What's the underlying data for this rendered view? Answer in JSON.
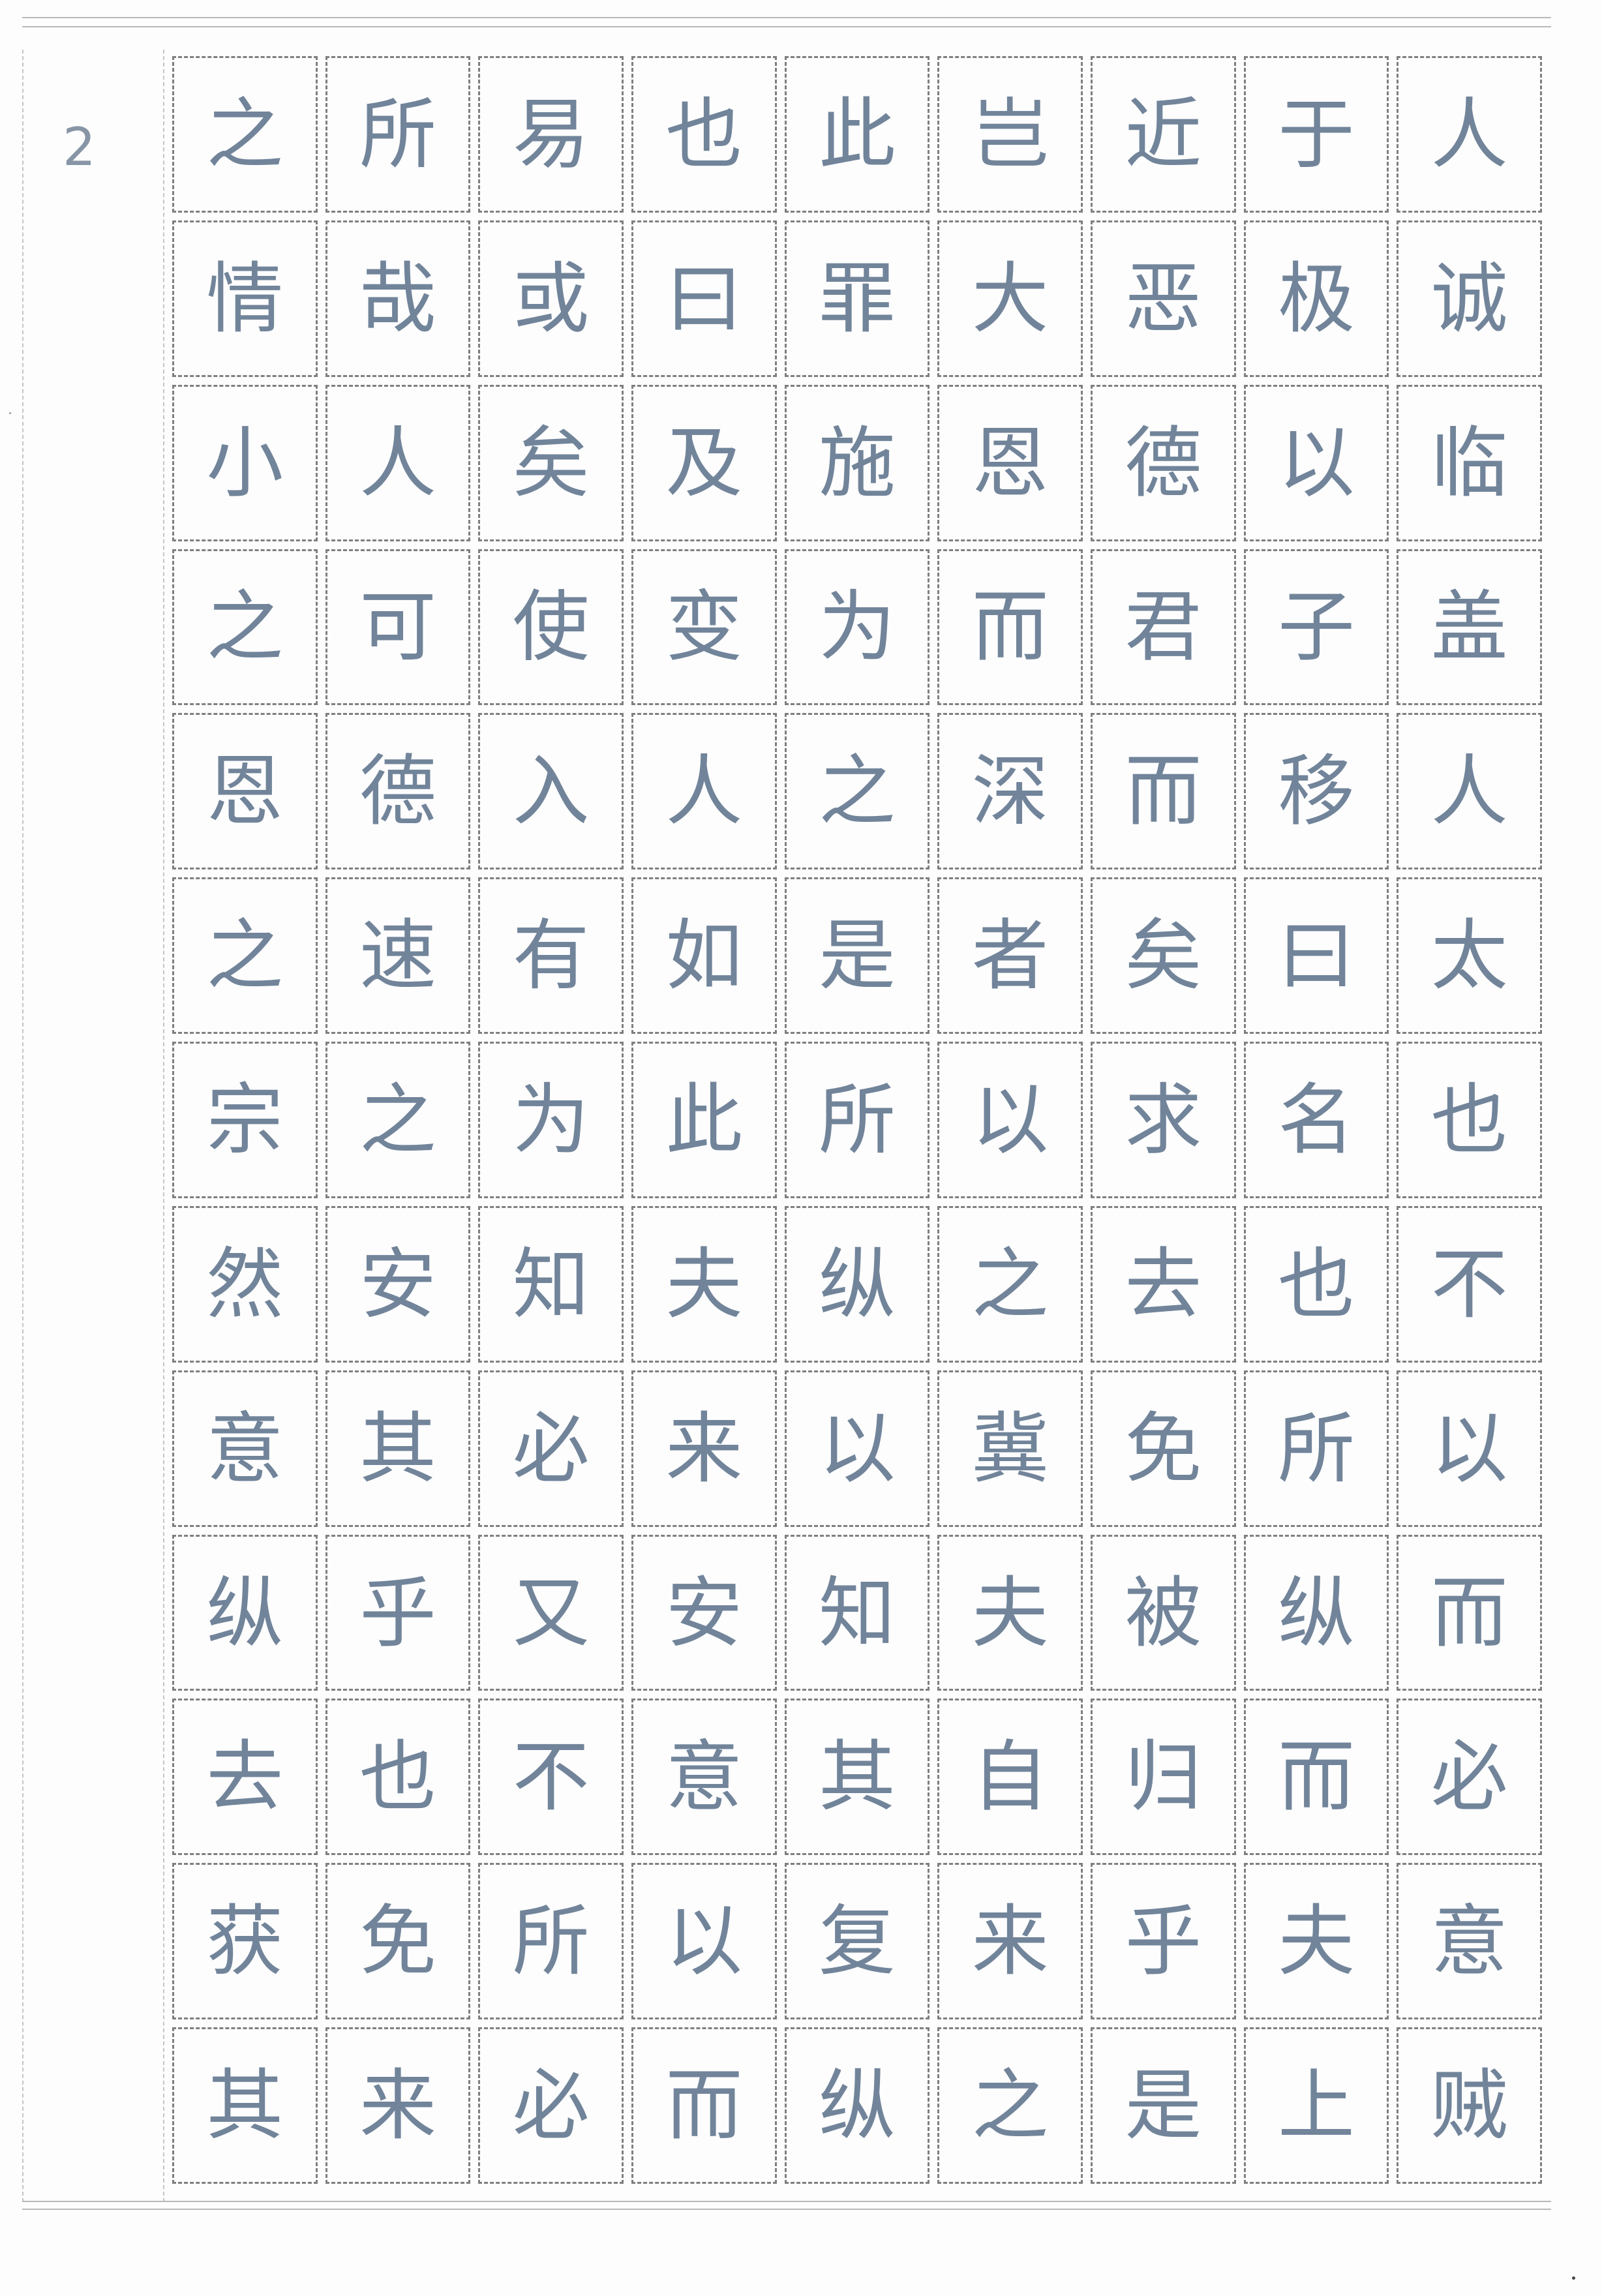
{
  "page": {
    "number": "2"
  },
  "grid": {
    "rows": [
      [
        "之",
        "所",
        "易",
        "也",
        "此",
        "岂",
        "近",
        "于",
        "人"
      ],
      [
        "情",
        "哉",
        "或",
        "曰",
        "罪",
        "大",
        "恶",
        "极",
        "诚"
      ],
      [
        "小",
        "人",
        "矣",
        "及",
        "施",
        "恩",
        "德",
        "以",
        "临"
      ],
      [
        "之",
        "可",
        "使",
        "变",
        "为",
        "而",
        "君",
        "子",
        "盖"
      ],
      [
        "恩",
        "德",
        "入",
        "人",
        "之",
        "深",
        "而",
        "移",
        "人"
      ],
      [
        "之",
        "速",
        "有",
        "如",
        "是",
        "者",
        "矣",
        "曰",
        "太"
      ],
      [
        "宗",
        "之",
        "为",
        "此",
        "所",
        "以",
        "求",
        "名",
        "也"
      ],
      [
        "然",
        "安",
        "知",
        "夫",
        "纵",
        "之",
        "去",
        "也",
        "不"
      ],
      [
        "意",
        "其",
        "必",
        "来",
        "以",
        "冀",
        "免",
        "所",
        "以"
      ],
      [
        "纵",
        "乎",
        "又",
        "安",
        "知",
        "夫",
        "被",
        "纵",
        "而"
      ],
      [
        "去",
        "也",
        "不",
        "意",
        "其",
        "自",
        "归",
        "而",
        "必"
      ],
      [
        "获",
        "免",
        "所",
        "以",
        "复",
        "来",
        "乎",
        "夫",
        "意"
      ],
      [
        "其",
        "来",
        "必",
        "而",
        "纵",
        "之",
        "是",
        "上",
        "贼"
      ]
    ]
  }
}
